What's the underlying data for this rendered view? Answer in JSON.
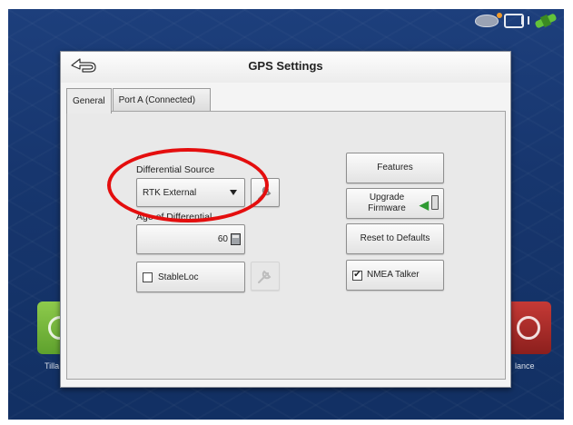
{
  "status_bar": {
    "icons": [
      "receiver-icon",
      "device-icon",
      "satellite-icon"
    ]
  },
  "background": {
    "left_label": "Tilla",
    "right_label": "lance"
  },
  "dialog": {
    "title": "GPS Settings",
    "back_icon": "back-arrow-icon",
    "tabs": [
      {
        "label": "General",
        "active": true
      },
      {
        "label": "Port A (Connected)",
        "active": false
      }
    ],
    "differential_source": {
      "label": "Differential Source",
      "value": "RTK External"
    },
    "age_of_differential": {
      "label": "Age of Differential",
      "value": "60"
    },
    "stableloc": {
      "label": "StableLoc",
      "checked": false
    },
    "buttons": {
      "features": "Features",
      "upgrade_firmware": "Upgrade Firmware",
      "reset_defaults": "Reset to Defaults",
      "nmea_talker": "NMEA Talker",
      "nmea_checkmark": "✔"
    }
  },
  "colors": {
    "annotation": "#e40e0e",
    "screen_background": "#17366e",
    "upgrade_arrow": "#2e9a32"
  }
}
